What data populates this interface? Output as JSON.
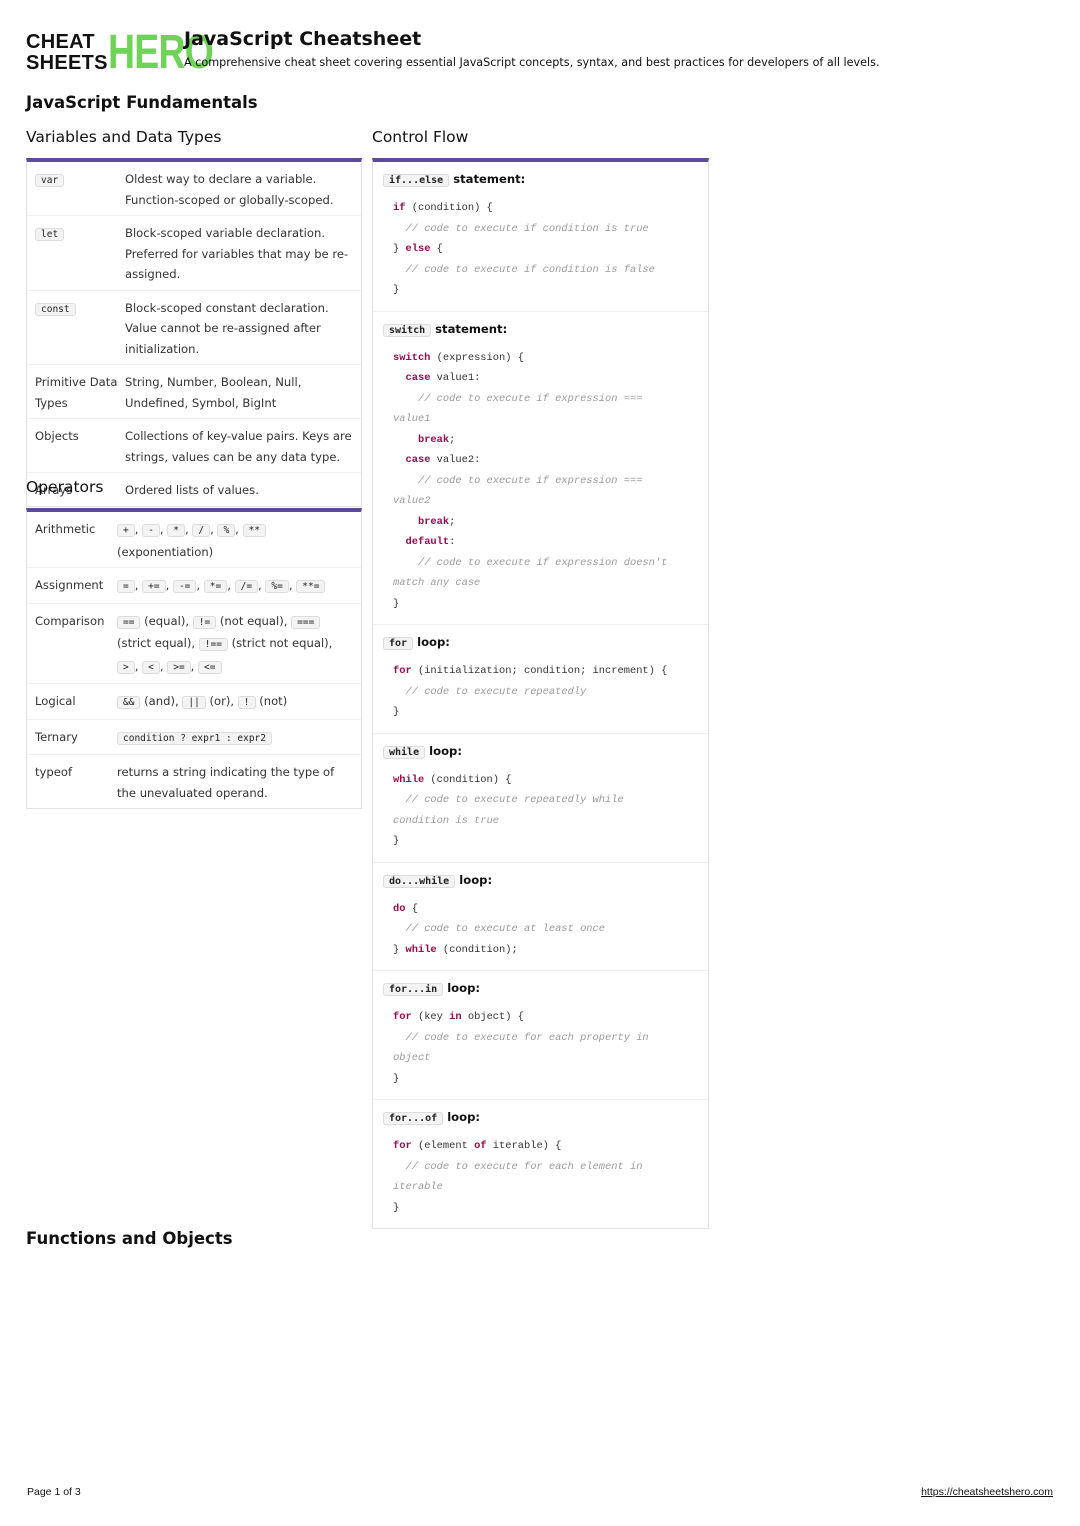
{
  "logo": {
    "line1": "CHEAT",
    "line2": "SHEETS",
    "hero": "HERO"
  },
  "header": {
    "title": "JavaScript Cheatsheet",
    "subtitle": "A comprehensive cheat sheet covering essential JavaScript concepts, syntax, and best practices for developers of all levels."
  },
  "sections": {
    "fundamentals": "JavaScript Fundamentals",
    "functions": "Functions and Objects"
  },
  "variables": {
    "title": "Variables and Data Types",
    "rows": [
      {
        "key": "var",
        "key_is_code": true,
        "value": "Oldest way to declare a variable. Function-scoped or globally-scoped."
      },
      {
        "key": "let",
        "key_is_code": true,
        "value": "Block-scoped variable declaration. Preferred for variables that may be re-assigned."
      },
      {
        "key": "const",
        "key_is_code": true,
        "value": "Block-scoped constant declaration. Value cannot be re-assigned after initialization."
      },
      {
        "key": "Primitive Data Types",
        "key_is_code": false,
        "value": "String, Number, Boolean, Null, Undefined, Symbol, BigInt"
      },
      {
        "key": "Objects",
        "key_is_code": false,
        "value": "Collections of key-value pairs. Keys are strings, values can be any data type."
      },
      {
        "key": "Arrays",
        "key_is_code": false,
        "value": "Ordered lists of values."
      }
    ]
  },
  "operators": {
    "title": "Operators",
    "rows": [
      {
        "key": "Arithmetic",
        "parts": [
          [
            "c",
            "+"
          ],
          [
            "t",
            ", "
          ],
          [
            "c",
            "-"
          ],
          [
            "t",
            ", "
          ],
          [
            "c",
            "*"
          ],
          [
            "t",
            ", "
          ],
          [
            "c",
            "/"
          ],
          [
            "t",
            ", "
          ],
          [
            "c",
            "%"
          ],
          [
            "t",
            ", "
          ],
          [
            "c",
            "**"
          ],
          [
            "t",
            " (exponentiation)"
          ]
        ]
      },
      {
        "key": "Assignment",
        "parts": [
          [
            "c",
            "="
          ],
          [
            "t",
            ", "
          ],
          [
            "c",
            "+="
          ],
          [
            "t",
            ", "
          ],
          [
            "c",
            "-="
          ],
          [
            "t",
            ", "
          ],
          [
            "c",
            "*="
          ],
          [
            "t",
            ", "
          ],
          [
            "c",
            "/="
          ],
          [
            "t",
            ", "
          ],
          [
            "c",
            "%="
          ],
          [
            "t",
            ", "
          ],
          [
            "c",
            "**="
          ]
        ]
      },
      {
        "key": "Comparison",
        "parts": [
          [
            "c",
            "=="
          ],
          [
            "t",
            " (equal), "
          ],
          [
            "c",
            "!="
          ],
          [
            "t",
            " (not equal), "
          ],
          [
            "c",
            "==="
          ],
          [
            "t",
            " (strict equal), "
          ],
          [
            "c",
            "!=="
          ],
          [
            "t",
            " (strict not equal), "
          ],
          [
            "c",
            ">"
          ],
          [
            "t",
            ", "
          ],
          [
            "c",
            "<"
          ],
          [
            "t",
            ", "
          ],
          [
            "c",
            ">="
          ],
          [
            "t",
            ", "
          ],
          [
            "c",
            "<="
          ]
        ]
      },
      {
        "key": "Logical",
        "parts": [
          [
            "c",
            "&&"
          ],
          [
            "t",
            " (and), "
          ],
          [
            "c",
            "||"
          ],
          [
            "t",
            " (or), "
          ],
          [
            "c",
            "!"
          ],
          [
            "t",
            " (not)"
          ]
        ]
      },
      {
        "key": "Ternary",
        "parts": [
          [
            "c",
            "condition ? expr1 : expr2"
          ]
        ]
      },
      {
        "key": "typeof",
        "parts": [
          [
            "t",
            "returns a string indicating the type of the unevaluated operand."
          ]
        ]
      }
    ]
  },
  "control_flow": {
    "title": "Control Flow",
    "blocks": [
      {
        "code_label": "if...else",
        "label": " statement:",
        "lines": [
          [
            [
              "k",
              "if"
            ],
            [
              "p",
              " (condition) {"
            ]
          ],
          [
            [
              "p",
              "  "
            ],
            [
              "m",
              "// code to execute if condition is true"
            ]
          ],
          [
            [
              "p",
              "} "
            ],
            [
              "k",
              "else"
            ],
            [
              "p",
              " {"
            ]
          ],
          [
            [
              "p",
              "  "
            ],
            [
              "m",
              "// code to execute if condition is false"
            ]
          ],
          [
            [
              "p",
              "}"
            ]
          ]
        ]
      },
      {
        "code_label": "switch",
        "label": " statement:",
        "lines": [
          [
            [
              "k",
              "switch"
            ],
            [
              "p",
              " (expression) {"
            ]
          ],
          [
            [
              "p",
              "  "
            ],
            [
              "k",
              "case"
            ],
            [
              "p",
              " value1:"
            ]
          ],
          [
            [
              "p",
              "    "
            ],
            [
              "m",
              "// code to execute if expression === value1"
            ]
          ],
          [
            [
              "p",
              "    "
            ],
            [
              "k",
              "break"
            ],
            [
              "p",
              ";"
            ]
          ],
          [
            [
              "p",
              "  "
            ],
            [
              "k",
              "case"
            ],
            [
              "p",
              " value2:"
            ]
          ],
          [
            [
              "p",
              "    "
            ],
            [
              "m",
              "// code to execute if expression === value2"
            ]
          ],
          [
            [
              "p",
              "    "
            ],
            [
              "k",
              "break"
            ],
            [
              "p",
              ";"
            ]
          ],
          [
            [
              "p",
              "  "
            ],
            [
              "k",
              "default"
            ],
            [
              "p",
              ":"
            ]
          ],
          [
            [
              "p",
              "    "
            ],
            [
              "m",
              "// code to execute if expression doesn't match any case"
            ]
          ],
          [
            [
              "p",
              "}"
            ]
          ]
        ]
      },
      {
        "code_label": "for",
        "label": " loop:",
        "lines": [
          [
            [
              "k",
              "for"
            ],
            [
              "p",
              " (initialization; condition; increment) {"
            ]
          ],
          [
            [
              "p",
              "  "
            ],
            [
              "m",
              "// code to execute repeatedly"
            ]
          ],
          [
            [
              "p",
              "}"
            ]
          ]
        ]
      },
      {
        "code_label": "while",
        "label": " loop:",
        "lines": [
          [
            [
              "k",
              "while"
            ],
            [
              "p",
              " (condition) {"
            ]
          ],
          [
            [
              "p",
              "  "
            ],
            [
              "m",
              "// code to execute repeatedly while condition is true"
            ]
          ],
          [
            [
              "p",
              "}"
            ]
          ]
        ]
      },
      {
        "code_label": "do...while",
        "label": " loop:",
        "lines": [
          [
            [
              "k",
              "do"
            ],
            [
              "p",
              " {"
            ]
          ],
          [
            [
              "p",
              "  "
            ],
            [
              "m",
              "// code to execute at least once"
            ]
          ],
          [
            [
              "p",
              "} "
            ],
            [
              "k",
              "while"
            ],
            [
              "p",
              " (condition);"
            ]
          ]
        ]
      },
      {
        "code_label": "for...in",
        "label": " loop:",
        "lines": [
          [
            [
              "k",
              "for"
            ],
            [
              "p",
              " (key "
            ],
            [
              "k",
              "in"
            ],
            [
              "p",
              " object) {"
            ]
          ],
          [
            [
              "p",
              "  "
            ],
            [
              "m",
              "// code to execute for each property in object"
            ]
          ],
          [
            [
              "p",
              "}"
            ]
          ]
        ]
      },
      {
        "code_label": "for...of",
        "label": " loop:",
        "lines": [
          [
            [
              "k",
              "for"
            ],
            [
              "p",
              " (element "
            ],
            [
              "k",
              "of"
            ],
            [
              "p",
              " iterable) {"
            ]
          ],
          [
            [
              "p",
              "  "
            ],
            [
              "m",
              "// code to execute for each element in iterable"
            ]
          ],
          [
            [
              "p",
              "}"
            ]
          ]
        ]
      }
    ]
  },
  "footer": {
    "page": "Page 1 of 3",
    "url": "https://cheatsheetshero.com"
  },
  "colors": {
    "accent_bar": "#5b4a9a",
    "logo_green": "#6fd35a",
    "keyword": "#9a0b4f",
    "comment": "#9a9a9a"
  }
}
